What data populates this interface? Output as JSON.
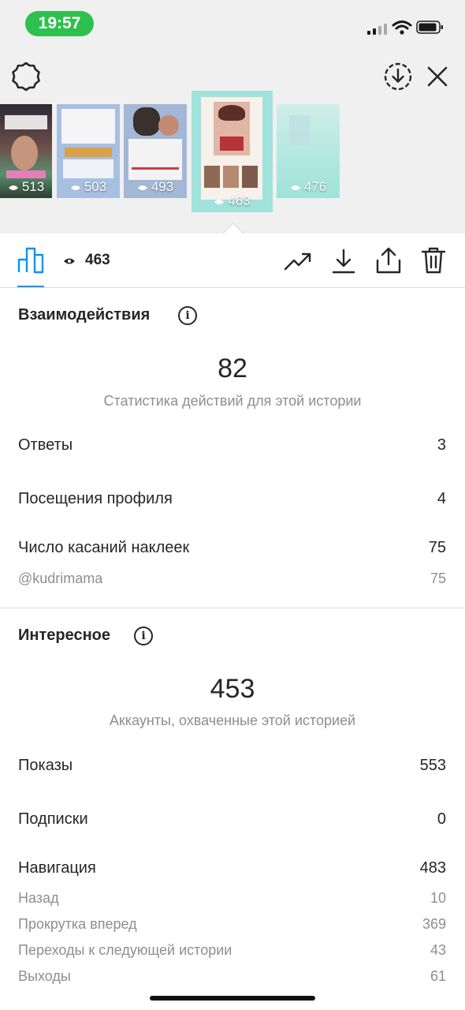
{
  "status_bar": {
    "time": "19:57"
  },
  "stories": [
    {
      "views": "513"
    },
    {
      "views": "503"
    },
    {
      "views": "493"
    },
    {
      "views": "463",
      "selected": true
    },
    {
      "views": "476"
    }
  ],
  "header": {
    "settings_icon": "gear-icon",
    "download_icon": "download-circle-icon",
    "close_icon": "close-icon"
  },
  "tabbar": {
    "view_count": "463",
    "icons": [
      "bar-chart-icon",
      "eye-icon",
      "trending-icon",
      "download-icon",
      "share-icon",
      "trash-icon"
    ]
  },
  "interactions": {
    "title": "Взаимодействия",
    "total": "82",
    "caption": "Статистика действий для этой истории",
    "rows": [
      {
        "label": "Ответы",
        "value": "3"
      },
      {
        "label": "Посещения профиля",
        "value": "4"
      },
      {
        "label": "Число касаний наклеек",
        "value": "75"
      }
    ],
    "sticker": {
      "label": "@kudrimama",
      "value": "75"
    }
  },
  "discovery": {
    "title": "Интересное",
    "total": "453",
    "caption": "Аккаунты, охваченные этой историей",
    "rows": [
      {
        "label": "Показы",
        "value": "553"
      },
      {
        "label": "Подписки",
        "value": "0"
      },
      {
        "label": "Навигация",
        "value": "483"
      }
    ],
    "navigation": [
      {
        "label": "Назад",
        "value": "10"
      },
      {
        "label": "Прокрутка вперед",
        "value": "369"
      },
      {
        "label": "Переходы к следующей истории",
        "value": "43"
      },
      {
        "label": "Выходы",
        "value": "61"
      }
    ]
  },
  "colors": {
    "accent": "#0095f6",
    "status_green": "#2ec04f",
    "text": "#262626",
    "secondary": "#8e8e8e"
  }
}
